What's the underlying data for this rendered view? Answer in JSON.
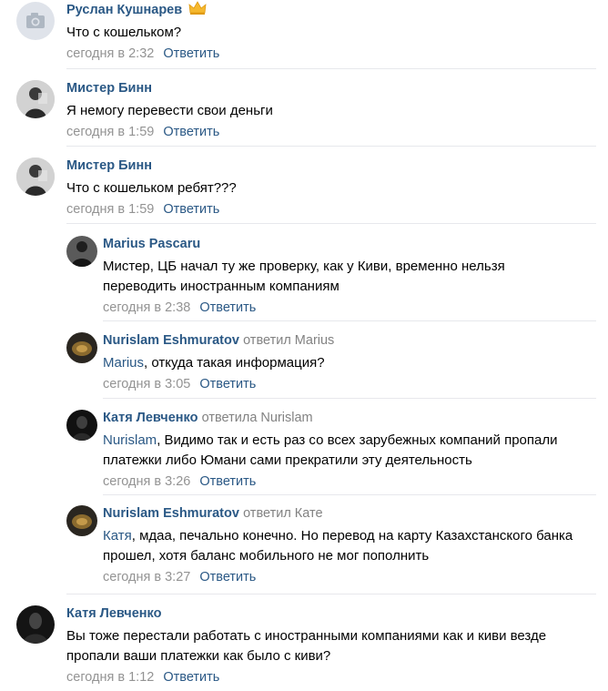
{
  "reply_label": "Ответить",
  "comments": [
    {
      "author": "Руслан Кушнарев",
      "text": "Что с кошельком?",
      "time": "сегодня в 2:32",
      "avatar": "camera-placeholder-icon",
      "badge": "crown-icon"
    },
    {
      "author": "Мистер Бинн",
      "text": "Я немогу перевести свои деньги",
      "time": "сегодня в 1:59",
      "avatar": "user-photo"
    },
    {
      "author": "Мистер Бинн",
      "text": "Что с кошельком ребят???",
      "time": "сегодня в 1:59",
      "avatar": "user-photo",
      "replies": [
        {
          "author": "Marius Pascaru",
          "mention": "",
          "text": "Мистер, ЦБ начал ту же проверку, как у Киви, временно нельзя переводить иностранным компаниям",
          "time": "сегодня в 2:38"
        },
        {
          "author": "Nurislam Eshmuratov",
          "replied_to": "ответил Marius",
          "mention": "Marius",
          "text": ", откуда такая информация?",
          "time": "сегодня в 3:05"
        },
        {
          "author": "Катя Левченко",
          "replied_to": "ответила Nurislam",
          "mention": "Nurislam",
          "text": ", Видимо так и есть раз со всех зарубежных компаний пропали платежки либо Юмани сами прекратили эту деятельность",
          "time": "сегодня в 3:26"
        },
        {
          "author": "Nurislam Eshmuratov",
          "replied_to": "ответил Кате",
          "mention": "Катя",
          "text": ", мдаа, печально конечно. Но перевод на карту Казахстанского банка прошел, хотя баланс мобильного не мог пополнить",
          "time": "сегодня в 3:27"
        }
      ]
    },
    {
      "author": "Катя Левченко",
      "text": "Вы тоже перестали работать с иностранными компаниями как и киви везде пропали ваши платежки как было с киви?",
      "time": "сегодня в 1:12",
      "avatar": "user-photo"
    }
  ],
  "colors": {
    "link": "#2a5885",
    "meta": "#939393",
    "separator": "#e7e8ec",
    "badge": "#f5b82e"
  }
}
